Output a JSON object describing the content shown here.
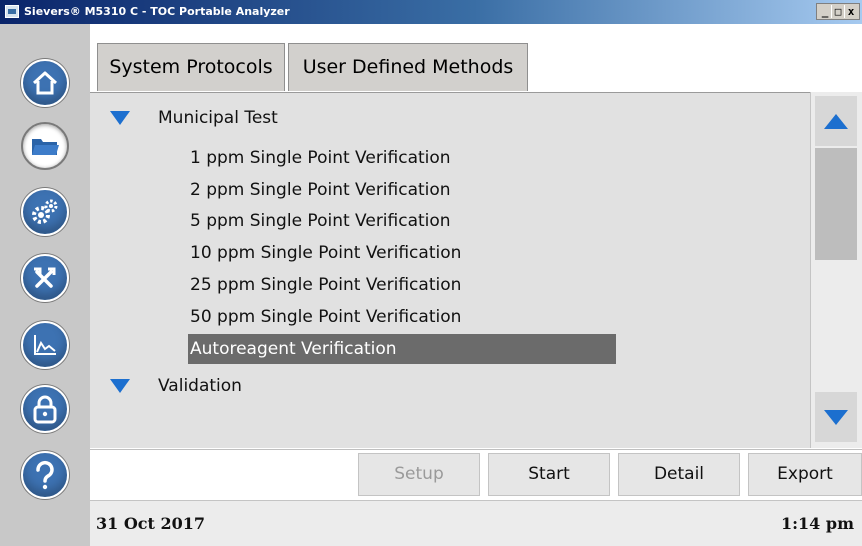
{
  "window": {
    "title": "Sievers® M5310 C - TOC Portable Analyzer",
    "controls": {
      "minimize": "_",
      "maximize": "□",
      "close": "x"
    }
  },
  "nav": {
    "items": [
      {
        "icon": "home-icon",
        "active": false
      },
      {
        "icon": "folder-icon",
        "active": true
      },
      {
        "icon": "gears-icon",
        "active": false
      },
      {
        "icon": "tools-icon",
        "active": false
      },
      {
        "icon": "chart-icon",
        "active": false
      },
      {
        "icon": "lock-icon",
        "active": false
      },
      {
        "icon": "help-icon",
        "active": false
      }
    ]
  },
  "tabs": [
    {
      "label": "System Protocols",
      "active": false
    },
    {
      "label": "User Defined Methods",
      "active": true
    }
  ],
  "list": {
    "groups": [
      {
        "label": "Municipal Test",
        "items": [
          "1 ppm Single Point Verification",
          "2 ppm Single Point Verification",
          "5 ppm Single Point Verification",
          "10 ppm Single Point Verification",
          "25 ppm Single Point Verification",
          "50 ppm Single Point Verification",
          "Autoreagent Verification"
        ],
        "selected_item": "Autoreagent Verification"
      },
      {
        "label": "Validation",
        "items": []
      }
    ]
  },
  "actions": {
    "setup": "Setup",
    "start": "Start",
    "detail": "Detail",
    "export": "Export"
  },
  "status": {
    "date": "31 Oct 2017",
    "time": "1:14 pm"
  },
  "colors": {
    "accent_blue": "#1c6fcf",
    "nav_button": "#3d72b2",
    "selected_row": "#6b6b6b"
  }
}
